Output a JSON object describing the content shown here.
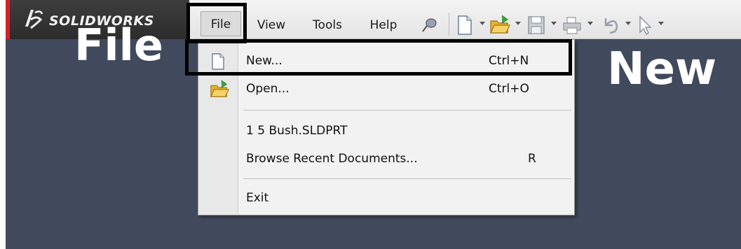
{
  "brand": {
    "name": "SOLIDWORKS",
    "accent": "#d2232a"
  },
  "menubar": {
    "items": [
      {
        "label": "File"
      },
      {
        "label": "View"
      },
      {
        "label": "Tools"
      },
      {
        "label": "Help"
      }
    ],
    "toolbar_icons": [
      "pin-icon",
      "new-document-icon",
      "open-folder-icon",
      "save-icon",
      "print-icon",
      "undo-icon",
      "select-pointer-icon"
    ]
  },
  "file_menu": {
    "items": [
      {
        "label": "New...",
        "shortcut": "Ctrl+N",
        "icon": "new-document-icon"
      },
      {
        "label": "Open...",
        "shortcut": "Ctrl+O",
        "icon": "open-folder-icon"
      },
      {
        "label": "1 5 Bush.SLDPRT"
      },
      {
        "label": "Browse Recent Documents...",
        "shortcut": "R"
      },
      {
        "label": "Exit"
      }
    ]
  },
  "annotations": {
    "file_caption": "File",
    "new_caption": "New"
  },
  "colors": {
    "background": "#414a5c",
    "menubar": "#ececec",
    "dropdown": "#f2f2f2",
    "highlight": "#000000"
  }
}
